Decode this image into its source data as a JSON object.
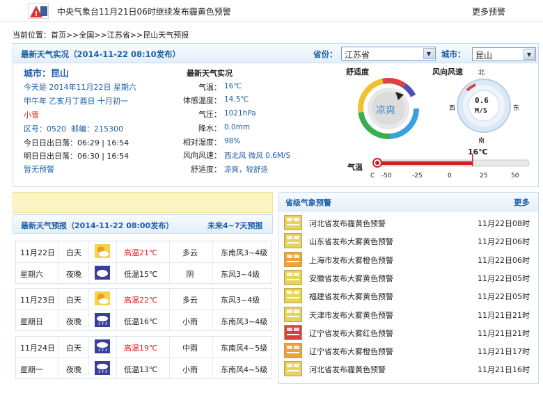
{
  "topbar": {
    "alert": "中央气象台11月21日06时继续发布霾黄色预警",
    "more": "更多预警"
  },
  "breadcrumb": "当前位置：首页>>全国>>江苏省>>昆山天气预报",
  "live": {
    "title": "最新天气实况（2014-11-22 08:10发布）",
    "province_label": "省份：",
    "province_value": "江苏省",
    "city_label": "城市：",
    "city_value": "昆山",
    "city_name": "城市：昆山",
    "today": "今天是 2014年11月22日 星期六",
    "lunar": "甲午年 乙亥月丁酉日 十月初一",
    "weather": "小雪",
    "codes": "区号：0520  邮编：215300",
    "sun_today": "今日日出日落：06:29 | 16:54",
    "sun_tomorrow": "明日日出日落：06:30 | 16:54",
    "no_warning": "暂无预警",
    "obs_title": "最新天气实况",
    "obs": [
      {
        "label": "气温：",
        "value": "16℃"
      },
      {
        "label": "体感温度：",
        "value": "14.5℃"
      },
      {
        "label": "气压：",
        "value": "1021hPa"
      },
      {
        "label": "降水：",
        "value": "0.0mm"
      },
      {
        "label": "相对湿度：",
        "value": "98%"
      },
      {
        "label": "风向风速：",
        "value": "西北风 微风 0.6M/S"
      },
      {
        "label": "舒适度：",
        "value": "凉爽，较舒适"
      }
    ],
    "comfort_title": "舒适度",
    "comfort_value": "凉爽",
    "wind_title": "风向风速",
    "wind_speed": "0.6",
    "wind_unit": "M/S",
    "compass": {
      "n": "北",
      "s": "南",
      "e": "东",
      "w": "西"
    },
    "temp_label": "气温",
    "temp_value": "16℃",
    "temp_current": 16,
    "temp_ticks": [
      "-50",
      "-25",
      "0",
      "25",
      "50"
    ],
    "temp_unit_tick": "C",
    "accent": "#1d5fa6"
  },
  "forecast": {
    "title": "最新天气预报（2014-11-22 08:00发布）",
    "more": "未来4~7天预报",
    "days": [
      {
        "date": "11月22日",
        "weekday": "星期六",
        "day": {
          "period": "白天",
          "temp": "高温21℃",
          "weather": "多云",
          "wind": "东南风3~4级",
          "icon": "sun-cloud-icon"
        },
        "night": {
          "period": "夜晚",
          "temp": "低温15℃",
          "weather": "阴",
          "wind": "东风3~4级",
          "icon": "cloud-icon"
        }
      },
      {
        "date": "11月23日",
        "weekday": "星期日",
        "day": {
          "period": "白天",
          "temp": "高温22℃",
          "weather": "多云",
          "wind": "东风3~4级",
          "icon": "sun-cloud-icon"
        },
        "night": {
          "period": "夜晚",
          "temp": "低温16℃",
          "weather": "小雨",
          "wind": "东南风3~4级",
          "icon": "rain-icon"
        }
      },
      {
        "date": "11月24日",
        "weekday": "星期一",
        "day": {
          "period": "白天",
          "temp": "高温19℃",
          "weather": "中雨",
          "wind": "东南风4~5级",
          "icon": "rain-icon"
        },
        "night": {
          "period": "夜晚",
          "temp": "低温13℃",
          "weather": "小雨",
          "wind": "东南风4~5级",
          "icon": "rain-icon"
        }
      }
    ]
  },
  "province": {
    "title": "省级气象预警",
    "more": "更多",
    "items": [
      {
        "text": "河北省发布霾黄色预警",
        "time": "11月22日08时",
        "color": "#e8d35a"
      },
      {
        "text": "山东省发布大雾黄色预警",
        "time": "11月22日06时",
        "color": "#e8d35a"
      },
      {
        "text": "上海市发布大雾橙色预警",
        "time": "11月22日06时",
        "color": "#f0a040"
      },
      {
        "text": "安徽省发布大雾黄色预警",
        "time": "11月22日05时",
        "color": "#e8d35a"
      },
      {
        "text": "福建省发布大雾黄色预警",
        "time": "11月22日05时",
        "color": "#e8d35a"
      },
      {
        "text": "天津市发布大雾黄色预警",
        "time": "11月21日21时",
        "color": "#e8d35a"
      },
      {
        "text": "辽宁省发布大雾红色预警",
        "time": "11月21日21时",
        "color": "#d84040"
      },
      {
        "text": "辽宁省发布大雾橙色预警",
        "time": "11月21日17时",
        "color": "#f0a040"
      },
      {
        "text": "河北省发布霾黄色预警",
        "time": "11月21日16时",
        "color": "#e8d35a"
      }
    ]
  }
}
